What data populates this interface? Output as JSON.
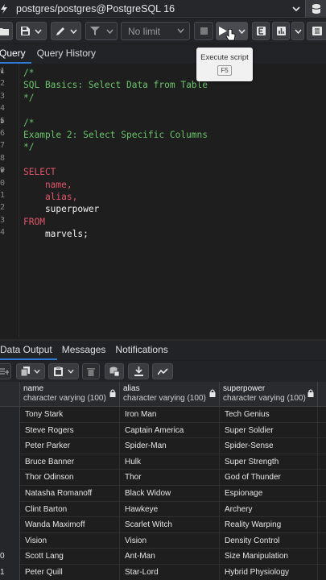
{
  "connection": {
    "title": "postgres/postgres@PostgreSQL 16"
  },
  "toolbar": {
    "limit_value": "No limit"
  },
  "tooltip": {
    "text": "Execute script",
    "shortcut": "F5"
  },
  "query_tabs": [
    {
      "label": "Query",
      "active": true
    },
    {
      "label": "Query History",
      "active": false
    }
  ],
  "editor": {
    "gutter": [
      {
        "num": "1",
        "fold": true
      },
      {
        "num": "2",
        "fold": false
      },
      {
        "num": "3",
        "fold": false
      },
      {
        "num": "4",
        "fold": false
      },
      {
        "num": "5",
        "fold": true
      },
      {
        "num": "6",
        "fold": false
      },
      {
        "num": "7",
        "fold": false
      },
      {
        "num": "8",
        "fold": false
      },
      {
        "num": "9",
        "fold": true
      },
      {
        "num": "0",
        "fold": false
      },
      {
        "num": "1",
        "fold": false
      },
      {
        "num": "2",
        "fold": false
      },
      {
        "num": "3",
        "fold": false
      },
      {
        "num": "4",
        "fold": false
      }
    ],
    "lines": [
      {
        "text": "/*",
        "style": "cmt"
      },
      {
        "text": "SQL Basics: Select Data from Table",
        "style": "cmt"
      },
      {
        "text": "*/",
        "style": "cmt"
      },
      {
        "text": "",
        "style": "plain"
      },
      {
        "text": "/*",
        "style": "cmt"
      },
      {
        "text": "Example 2: Select Specific Columns",
        "style": "cmt"
      },
      {
        "text": "*/",
        "style": "cmt"
      },
      {
        "text": "",
        "style": "plain"
      },
      {
        "text": "SELECT",
        "style": "kw"
      },
      {
        "text": "    name,",
        "style": "id"
      },
      {
        "text": "    alias,",
        "style": "id"
      },
      {
        "text": "    superpower",
        "style": "plain"
      },
      {
        "text": "FROM",
        "style": "kw"
      },
      {
        "text": "    marvels;",
        "style": "plain"
      }
    ]
  },
  "output_tabs": [
    {
      "label": "Data Output",
      "active": true
    },
    {
      "label": "Messages",
      "active": false
    },
    {
      "label": "Notifications",
      "active": false
    }
  ],
  "grid": {
    "columns": [
      {
        "name": "name",
        "type": "character varying (100)"
      },
      {
        "name": "alias",
        "type": "character varying (100)"
      },
      {
        "name": "superpower",
        "type": "character varying (100)"
      }
    ],
    "rows": [
      {
        "num": "",
        "cells": [
          "Tony Stark",
          "Iron Man",
          "Tech Genius"
        ]
      },
      {
        "num": "",
        "cells": [
          "Steve Rogers",
          "Captain America",
          "Super Soldier"
        ]
      },
      {
        "num": "",
        "cells": [
          "Peter Parker",
          "Spider-Man",
          "Spider-Sense"
        ]
      },
      {
        "num": "",
        "cells": [
          "Bruce Banner",
          "Hulk",
          "Super Strength"
        ]
      },
      {
        "num": "",
        "cells": [
          "Thor Odinson",
          "Thor",
          "God of Thunder"
        ]
      },
      {
        "num": "",
        "cells": [
          "Natasha Romanoff",
          "Black Widow",
          "Espionage"
        ]
      },
      {
        "num": "",
        "cells": [
          "Clint Barton",
          "Hawkeye",
          "Archery"
        ]
      },
      {
        "num": "",
        "cells": [
          "Wanda Maximoff",
          "Scarlet Witch",
          "Reality Warping"
        ]
      },
      {
        "num": "",
        "cells": [
          "Vision",
          "Vision",
          "Density Control"
        ]
      },
      {
        "num": "0",
        "cells": [
          "Scott Lang",
          "Ant-Man",
          "Size Manipulation"
        ]
      },
      {
        "num": "1",
        "cells": [
          "Peter Quill",
          "Star-Lord",
          "Hybrid Physiology"
        ]
      }
    ]
  }
}
